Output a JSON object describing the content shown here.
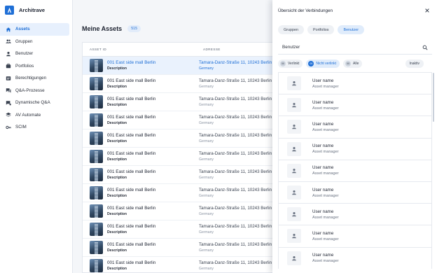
{
  "app": {
    "name": "Architrave",
    "logo_icon": "architrave-logo-icon",
    "accent_color": "#1f6fd6"
  },
  "sidebar": {
    "items": [
      {
        "label": "Assets",
        "icon": "home-icon",
        "active": true
      },
      {
        "label": "Gruppen",
        "icon": "groups-icon",
        "active": false
      },
      {
        "label": "Benutzer",
        "icon": "person-icon",
        "active": false
      },
      {
        "label": "Portfolios",
        "icon": "briefcase-icon",
        "active": false
      },
      {
        "label": "Berechtigungen",
        "icon": "permissions-icon",
        "active": false
      },
      {
        "label": "Q&A-Prozesse",
        "icon": "chat-icon",
        "active": false
      },
      {
        "label": "Dynamische Q&A",
        "icon": "dynamic-qa-icon",
        "active": false
      },
      {
        "label": "AV Automate",
        "icon": "layers-icon",
        "active": false
      },
      {
        "label": "SCIM",
        "icon": "key-icon",
        "active": false
      }
    ]
  },
  "main": {
    "title": "Meine Assets",
    "count": "515",
    "table": {
      "headers": {
        "asset_id": "ASSET ID",
        "address": "ADRESSE"
      },
      "rows": [
        {
          "name": "001 East side mall Berlin",
          "description": "Description",
          "street": "Tamara-Danz-Straße 11, 10243 Berlin",
          "country": "Germany",
          "selected": true
        },
        {
          "name": "001 East side mall Berlin",
          "description": "Description",
          "street": "Tamara-Danz-Straße 11, 10243 Berlin",
          "country": "Germany",
          "selected": false
        },
        {
          "name": "001 East side mall Berlin",
          "description": "Description",
          "street": "Tamara-Danz-Straße 11, 10243 Berlin",
          "country": "Germany",
          "selected": false
        },
        {
          "name": "001 East side mall Berlin",
          "description": "Description",
          "street": "Tamara-Danz-Straße 11, 10243 Berlin",
          "country": "Germany",
          "selected": false
        },
        {
          "name": "001 East side mall Berlin",
          "description": "Description",
          "street": "Tamara-Danz-Straße 11, 10243 Berlin",
          "country": "Germany",
          "selected": false
        },
        {
          "name": "001 East side mall Berlin",
          "description": "Description",
          "street": "Tamara-Danz-Straße 11, 10243 Berlin",
          "country": "Germany",
          "selected": false
        },
        {
          "name": "001 East side mall Berlin",
          "description": "Description",
          "street": "Tamara-Danz-Straße 11, 10243 Berlin",
          "country": "Germany",
          "selected": false
        },
        {
          "name": "001 East side mall Berlin",
          "description": "Description",
          "street": "Tamara-Danz-Straße 11, 10243 Berlin",
          "country": "Germany",
          "selected": false
        },
        {
          "name": "001 East side mall Berlin",
          "description": "Description",
          "street": "Tamara-Danz-Straße 11, 10243 Berlin",
          "country": "Germany",
          "selected": false
        },
        {
          "name": "001 East side mall Berlin",
          "description": "Description",
          "street": "Tamara-Danz-Straße 11, 10243 Berlin",
          "country": "Germany",
          "selected": false
        },
        {
          "name": "001 East side mall Berlin",
          "description": "Description",
          "street": "Tamara-Danz-Straße 11, 10243 Berlin",
          "country": "Germany",
          "selected": false
        },
        {
          "name": "001 East side mall Berlin",
          "description": "Description",
          "street": "Tamara-Danz-Straße 11, 10243 Berlin",
          "country": "Germany",
          "selected": false
        }
      ]
    }
  },
  "drawer": {
    "title": "Übersicht der Verbindungen",
    "close_icon": "close-icon",
    "tabs": [
      {
        "label": "Gruppen",
        "active": false
      },
      {
        "label": "Portfolios",
        "active": false
      },
      {
        "label": "Benutzer",
        "active": true
      }
    ],
    "search": {
      "placeholder": "Benutzer",
      "icon": "search-icon"
    },
    "filters": [
      {
        "count": "00",
        "label": "Verlinkt",
        "active": false
      },
      {
        "count": "00",
        "label": "Nicht verlinkt",
        "active": true
      },
      {
        "count": "00",
        "label": "Alle",
        "active": false
      }
    ],
    "inactive_label": "Inaktiv",
    "users": [
      {
        "name": "User name",
        "role": "Asset manager"
      },
      {
        "name": "User name",
        "role": "Asset manager"
      },
      {
        "name": "User name",
        "role": "Asset manager"
      },
      {
        "name": "User name",
        "role": "Asset manager"
      },
      {
        "name": "User name",
        "role": "Asset manager"
      },
      {
        "name": "User name",
        "role": "Asset manager"
      },
      {
        "name": "User name",
        "role": "Asset manager"
      },
      {
        "name": "User name",
        "role": "Asset manager"
      },
      {
        "name": "User name",
        "role": "Asset manager"
      }
    ]
  }
}
